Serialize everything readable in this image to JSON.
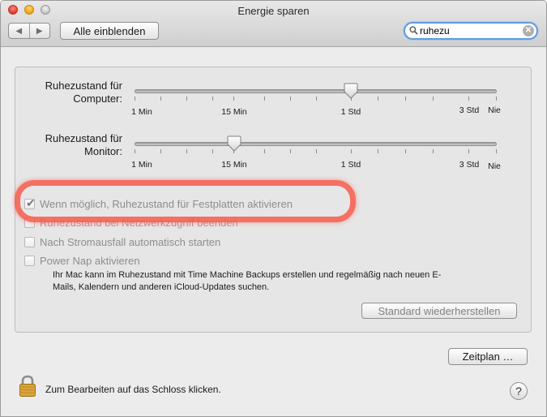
{
  "window": {
    "title": "Energie sparen"
  },
  "toolbar": {
    "back_glyph": "◀",
    "forward_glyph": "▶",
    "show_all_label": "Alle einblenden",
    "search_value": "ruhezu",
    "clear_glyph": "✕"
  },
  "sliders": [
    {
      "label_line1": "Ruhezustand für",
      "label_line2": "Computer:",
      "tick_labels": [
        "1 Min",
        "15 Min",
        "1 Std",
        "3 Std",
        "Nie"
      ],
      "value": "1 Std"
    },
    {
      "label_line1": "Ruhezustand für",
      "label_line2": "Monitor:",
      "tick_labels": [
        "1 Min",
        "15 Min",
        "1 Std",
        "3 Std",
        "Nie"
      ],
      "value": "15 Min"
    }
  ],
  "options": [
    {
      "label": "Wenn möglich, Ruhezustand für Festplatten aktivieren",
      "checked": true
    },
    {
      "label": "Ruhezustand bei Netzwerkzugriff beenden",
      "checked": false
    },
    {
      "label": "Nach Stromausfall automatisch starten",
      "checked": false
    },
    {
      "label": "Power Nap aktivieren",
      "checked": false
    }
  ],
  "power_nap_description": {
    "line1": "Ihr Mac kann im Ruhezustand mit Time Machine Backups erstellen und regelmäßig nach neuen E-",
    "line2": "Mails, Kalendern und anderen iCloud-Updates suchen."
  },
  "buttons": {
    "restore_defaults": "Standard wiederherstellen",
    "schedule": "Zeitplan …",
    "help": "?"
  },
  "lock": {
    "text": "Zum Bearbeiten auf das Schloss klicken."
  },
  "colors": {
    "highlight": "#f45a4b",
    "search_focus": "#5d9ae4"
  }
}
